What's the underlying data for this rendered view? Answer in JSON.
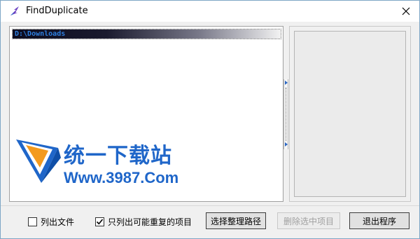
{
  "window": {
    "title": "FindDuplicate"
  },
  "tree": {
    "items": [
      {
        "label": "D:\\Downloads"
      }
    ]
  },
  "watermark": {
    "chinese": "统一下载站",
    "url": "Www.3987.Com"
  },
  "options": {
    "list_files_label": "列出文件",
    "list_files_checked": false,
    "only_dup_label": "只列出可能重复的项目",
    "only_dup_checked": true
  },
  "buttons": {
    "select_path": "选择整理路径",
    "delete_selected": "删除选中项目",
    "exit": "退出程序"
  },
  "colors": {
    "accent": "#1f66c9",
    "tree_label": "#2e7fe0"
  }
}
